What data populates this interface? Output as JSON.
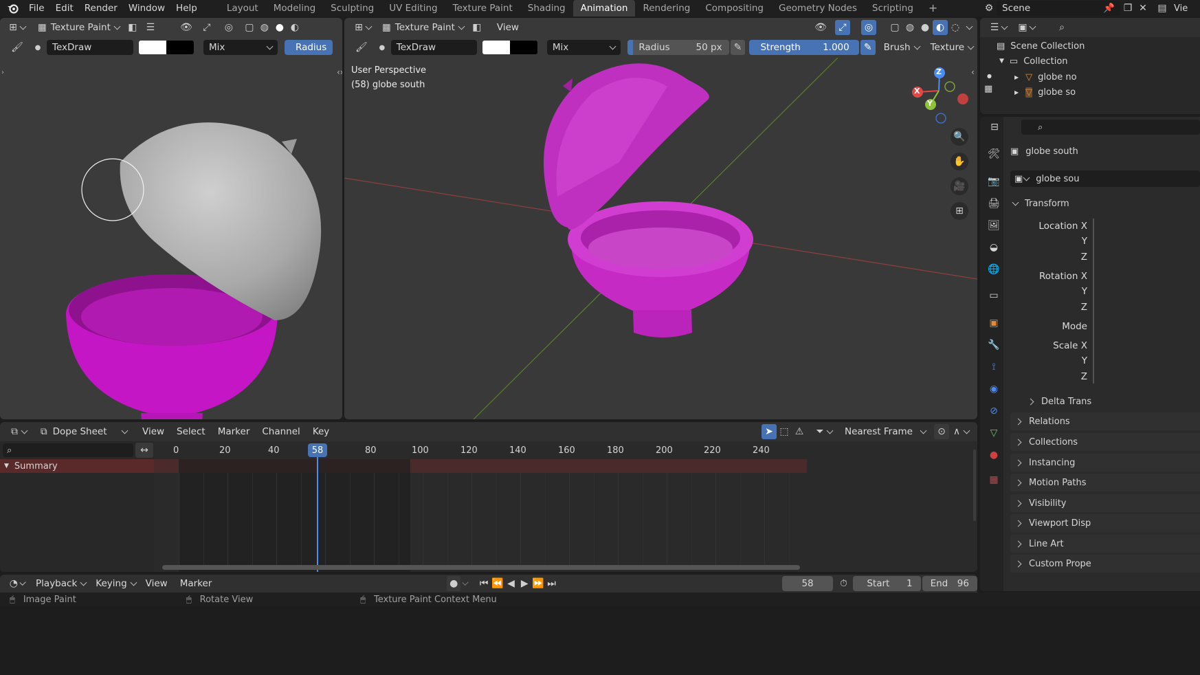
{
  "topbar": {
    "menus": [
      "File",
      "Edit",
      "Render",
      "Window",
      "Help"
    ],
    "workspaces": [
      "Layout",
      "Modeling",
      "Sculpting",
      "UV Editing",
      "Texture Paint",
      "Shading",
      "Animation",
      "Rendering",
      "Compositing",
      "Geometry Nodes",
      "Scripting"
    ],
    "active_workspace": "Animation",
    "add_tab": "+",
    "scene_name": "Scene",
    "view_layer": "Vie"
  },
  "left_view": {
    "mode": "Texture Paint",
    "brush_name": "TexDraw",
    "blend": "Mix",
    "radius_label": "Radius"
  },
  "main_view": {
    "mode": "Texture Paint",
    "view_menu": "View",
    "brush_name": "TexDraw",
    "blend": "Mix",
    "radius_label": "Radius",
    "radius_value": "50 px",
    "strength_label": "Strength",
    "strength_value": "1.000",
    "brush_menu": "Brush",
    "texture_menu": "Texture",
    "perspective": "User Perspective",
    "object_info": "(58) globe south",
    "gizmo": {
      "x": "X",
      "y": "Y",
      "z": "Z"
    }
  },
  "outliner": {
    "scene_collection": "Scene Collection",
    "collection": "Collection",
    "items": [
      "globe no",
      "globe so"
    ]
  },
  "properties": {
    "object_name": "globe south",
    "data_name": "globe sou",
    "transform": "Transform",
    "location_x": "Location X",
    "y": "Y",
    "z": "Z",
    "rotation_x": "Rotation X",
    "mode": "Mode",
    "scale_x": "Scale X",
    "delta": "Delta Trans",
    "sections": [
      "Relations",
      "Collections",
      "Instancing",
      "Motion Paths",
      "Visibility",
      "Viewport Disp",
      "Line Art",
      "Custom Prope"
    ]
  },
  "dopesheet": {
    "editor": "Dope Sheet",
    "menus": [
      "View",
      "Select",
      "Marker",
      "Channel",
      "Key"
    ],
    "snap": "Nearest Frame",
    "frame_ticks": [
      "0",
      "20",
      "40",
      "58",
      "80",
      "100",
      "120",
      "140",
      "160",
      "180",
      "200",
      "220",
      "240"
    ],
    "current_frame": "58",
    "summary": "Summary"
  },
  "timeline": {
    "menus": [
      "Playback",
      "Keying",
      "View",
      "Marker"
    ],
    "current_frame": "58",
    "start_label": "Start",
    "start_value": "1",
    "end_label": "End",
    "end_value": "96"
  },
  "statusbar": {
    "hint1": "Image Paint",
    "hint2": "Rotate View",
    "hint3": "Texture Paint Context Menu"
  },
  "colors": {
    "accent_blue": "#4772b3",
    "magenta": "#cc33cc",
    "grey_mesh": "#b9b9b9",
    "summary_red": "#5a2a2a"
  }
}
